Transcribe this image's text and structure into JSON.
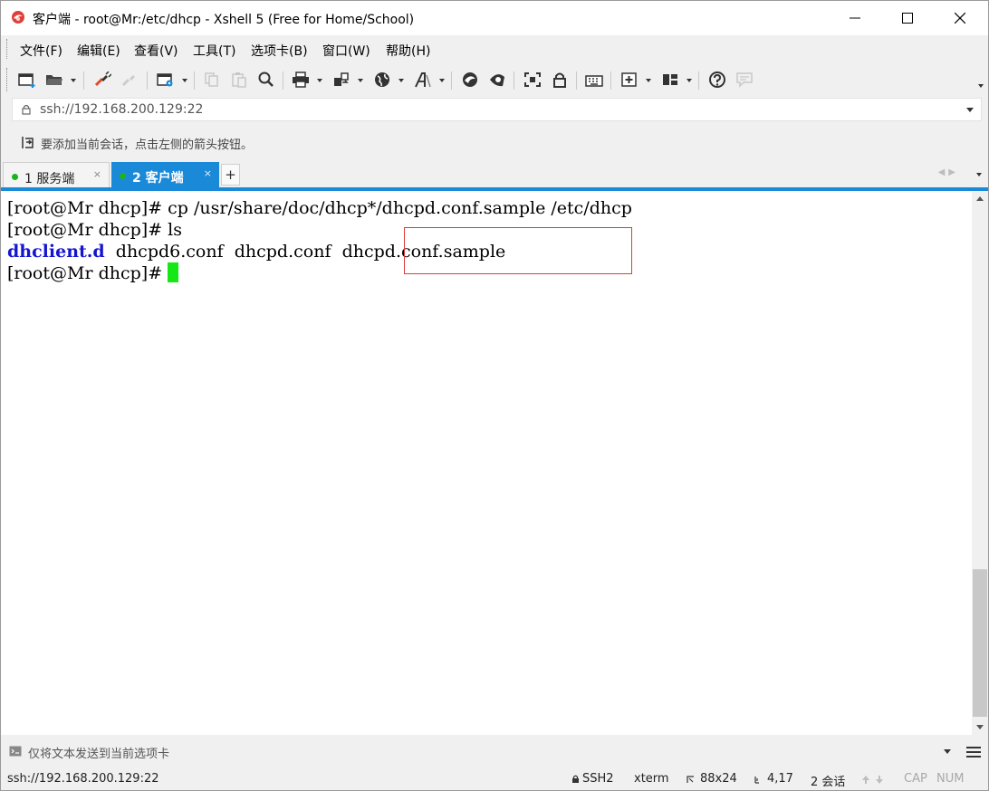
{
  "window": {
    "title": "客户端 - root@Mr:/etc/dhcp - Xshell 5 (Free for Home/School)"
  },
  "menu": [
    {
      "label": "文件(F)"
    },
    {
      "label": "编辑(E)"
    },
    {
      "label": "查看(V)"
    },
    {
      "label": "工具(T)"
    },
    {
      "label": "选项卡(B)"
    },
    {
      "label": "窗口(W)"
    },
    {
      "label": "帮助(H)"
    }
  ],
  "toolbar_icons": [
    "new-session-icon",
    "open-folder-icon",
    "connect-icon",
    "disconnect-icon",
    "properties-icon",
    "copy-icon",
    "paste-icon",
    "find-icon",
    "print-icon",
    "transfer-icon",
    "globe-icon",
    "font-icon",
    "xftp-icon",
    "xagent-icon",
    "fullscreen-icon",
    "lock-icon",
    "keyboard-icon",
    "new-tab-icon",
    "layout-icon",
    "help-icon",
    "chat-icon"
  ],
  "address": {
    "value": "ssh://192.168.200.129:22"
  },
  "info": {
    "text": "要添加当前会话，点击左侧的箭头按钮。"
  },
  "tabs": [
    {
      "label": "1 服务端",
      "active": false,
      "status_color": "#1cb41c"
    },
    {
      "label": "2 客户端",
      "active": true,
      "status_color": "#1cb41c"
    }
  ],
  "tab_add_label": "+",
  "tab_close_label": "×",
  "terminal": {
    "line1": "[root@Mr dhcp]# cp /usr/share/doc/dhcp*/dhcpd.conf.sample /etc/dhcp",
    "line2": "[root@Mr dhcp]# ls",
    "ls_dir": "dhclient.d",
    "ls_file1": "dhcpd6.conf",
    "ls_file2": "dhcpd.conf",
    "ls_file3": "dhcpd.conf.sample",
    "line4_prompt": "[root@Mr dhcp]# "
  },
  "compose": {
    "placeholder": "仅将文本发送到当前选项卡"
  },
  "status": {
    "address": "ssh://192.168.200.129:22",
    "protocol": "SSH2",
    "terminal_type": "xterm",
    "size": "88x24",
    "cursor_pos": "4,17",
    "sessions": "2 会话",
    "cap": "CAP",
    "num": "NUM"
  },
  "colors": {
    "accent": "#1a8ad8",
    "cursor": "#16e816",
    "directory": "#1515d0",
    "highlight_border": "#e03a3a"
  }
}
